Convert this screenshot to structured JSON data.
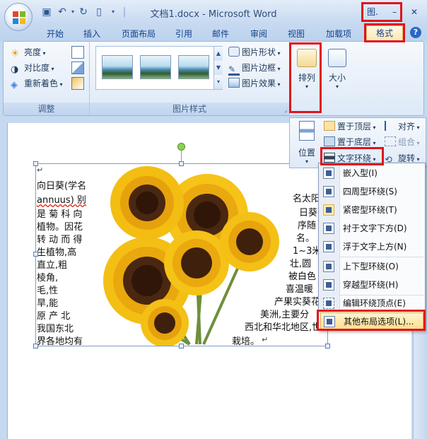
{
  "window": {
    "title": "文档1.docx - Microsoft Word",
    "context_tab_label": "图.",
    "minimize_label": "–",
    "close_label": "✕"
  },
  "tabs": [
    "开始",
    "插入",
    "页面布局",
    "引用",
    "邮件",
    "审阅",
    "视图",
    "加载项",
    "格式"
  ],
  "ribbon": {
    "adjust_group": {
      "label": "调整",
      "brightness": "亮度",
      "contrast": "对比度",
      "recolor": "重新着色"
    },
    "styles_group": {
      "label": "图片样式",
      "shape": "图片形状",
      "border": "图片边框",
      "effects": "图片效果"
    },
    "arrange_button": "排列",
    "size_button": "大小"
  },
  "arrange_panel": {
    "position_button": "位置",
    "bring_front": "置于顶层",
    "send_back": "置于底层",
    "text_wrap": "文字环绕",
    "align": "对齐",
    "group": "组合",
    "rotate": "旋转"
  },
  "wrap_menu": {
    "items": [
      "嵌入型(I)",
      "四周型环绕(S)",
      "紧密型环绕(T)",
      "衬于文字下方(D)",
      "浮于文字上方(N)",
      "上下型环绕(O)",
      "穿越型环绕(H)",
      "编辑环绕顶点(E)",
      "其他布局选项(L)..."
    ]
  },
  "document": {
    "left_lines": [
      "向日葵(学名",
      "annuus) 别",
      "是 菊 科 向",
      "植物。因花",
      "转 动 而 得",
      "生植物,高",
      "直立,粗",
      "棱角,",
      "毛,性",
      "旱,能",
      "原 产 北",
      "我国东北",
      "界各地均有"
    ],
    "right_lines": [
      "名太阳",
      "日葵",
      "序随",
      "名。",
      "1~3米",
      "壮,圆",
      "被白色",
      "喜温暖",
      "产果实葵花",
      "美洲,主要分",
      "西北和华北地区,世",
      "栽培。"
    ],
    "para_mark": "↵"
  }
}
